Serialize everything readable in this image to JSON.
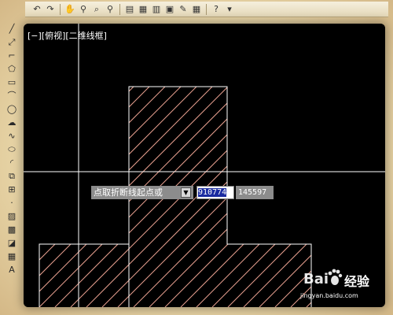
{
  "toolbar": {
    "icons": [
      "undo-icon",
      "redo-icon",
      "pan-icon",
      "zoom-realtime-icon",
      "zoom-window-icon",
      "zoom-previous-icon",
      "properties-icon",
      "design-center-icon",
      "tool-palettes-icon",
      "sheet-set-icon",
      "markup-icon",
      "calculator-icon",
      "help-icon"
    ]
  },
  "left_toolbar": {
    "icons": [
      "line-icon",
      "construction-line-icon",
      "polyline-icon",
      "polygon-icon",
      "rectangle-icon",
      "arc-icon",
      "circle-icon",
      "revision-cloud-icon",
      "spline-icon",
      "ellipse-icon",
      "ellipse-arc-icon",
      "insert-block-icon",
      "make-block-icon",
      "point-icon",
      "hatch-icon",
      "gradient-icon",
      "region-icon",
      "table-icon",
      "multiline-text-icon"
    ]
  },
  "viewport": {
    "label": "[−][俯视][二维线框]"
  },
  "dynamic_input": {
    "prompt": "点取折断线起点或",
    "coord_x": "910774",
    "coord_y": "145597"
  },
  "watermark": {
    "brand": "经验",
    "url": "jingyan.baidu.com"
  },
  "colors": {
    "canvas": "#000000",
    "hatch": "#e8a090",
    "outline": "#ffffff",
    "crosshair": "#ffffff"
  }
}
